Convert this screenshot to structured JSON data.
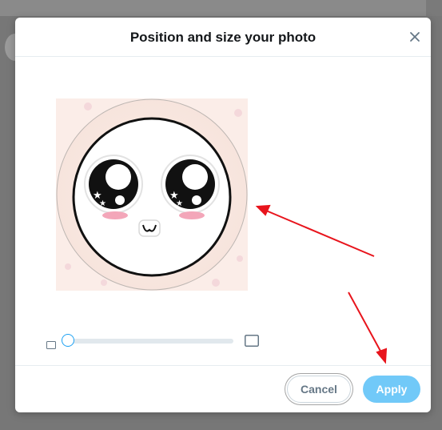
{
  "modal": {
    "title": "Position and size your photo",
    "close_icon": "close-icon"
  },
  "zoom_slider": {
    "value": 0,
    "min_icon": "small-image-icon",
    "max_icon": "large-image-icon"
  },
  "footer": {
    "cancel_label": "Cancel",
    "apply_label": "Apply"
  },
  "colors": {
    "accent": "#1da1f2",
    "apply_bg": "#71c9f8",
    "annotation_arrow": "#e8141c"
  }
}
